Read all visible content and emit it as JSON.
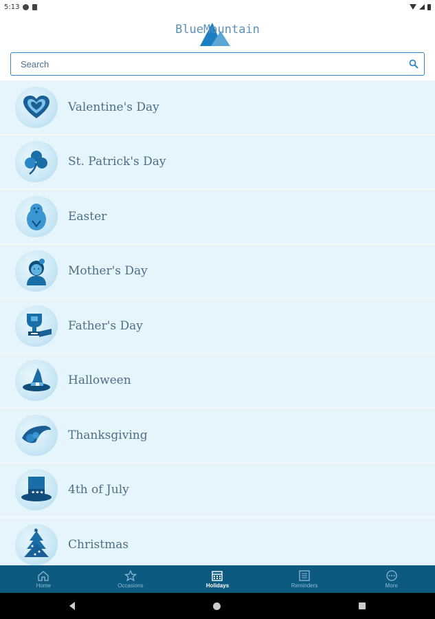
{
  "status": {
    "time": "5:13"
  },
  "logo": {
    "text": "BlueMountain"
  },
  "search": {
    "placeholder": "Search"
  },
  "holidays": [
    {
      "label": "Valentine's Day",
      "icon": "heart-icon"
    },
    {
      "label": "St. Patrick's Day",
      "icon": "shamrock-icon"
    },
    {
      "label": "Easter",
      "icon": "chick-icon"
    },
    {
      "label": "Mother's Day",
      "icon": "mother-icon"
    },
    {
      "label": "Father's Day",
      "icon": "trophy-icon"
    },
    {
      "label": "Halloween",
      "icon": "witch-hat-icon"
    },
    {
      "label": "Thanksgiving",
      "icon": "cornucopia-icon"
    },
    {
      "label": "4th of July",
      "icon": "uncle-sam-hat-icon"
    },
    {
      "label": "Christmas",
      "icon": "christmas-tree-icon"
    }
  ],
  "tabs": [
    {
      "label": "Home",
      "icon": "home-icon"
    },
    {
      "label": "Occasions",
      "icon": "star-icon"
    },
    {
      "label": "Holidays",
      "icon": "calendar-icon"
    },
    {
      "label": "Reminders",
      "icon": "list-icon"
    },
    {
      "label": "More",
      "icon": "more-icon"
    }
  ],
  "colors": {
    "accent": "#2f86c6",
    "tabbar": "#0d5a80",
    "row": "#e6f4fb",
    "icon": "#1a6ea8"
  }
}
